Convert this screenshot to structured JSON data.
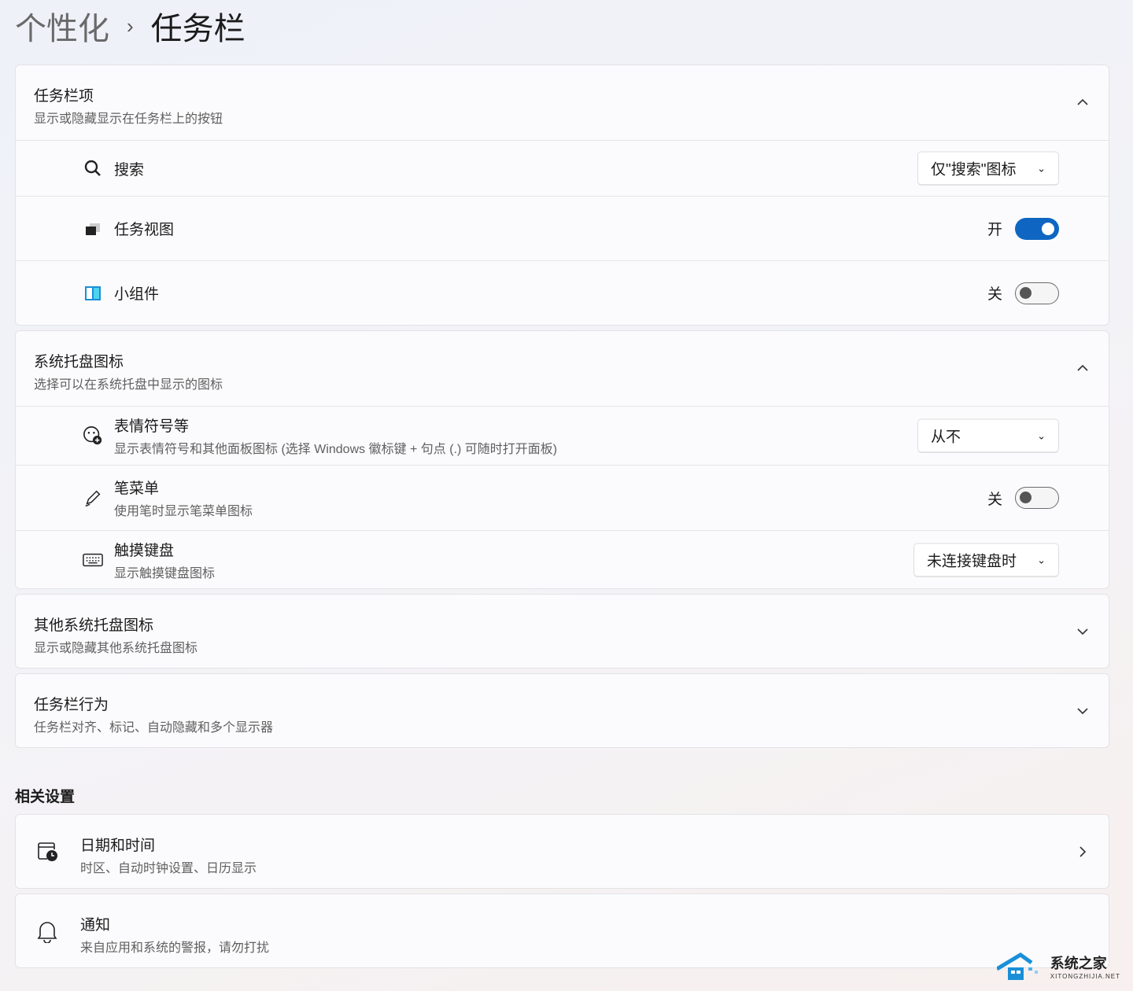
{
  "breadcrumb": {
    "parent": "个性化",
    "separator": "›",
    "current": "任务栏"
  },
  "taskbar_items": {
    "title": "任务栏项",
    "subtitle": "显示或隐藏显示在任务栏上的按钮",
    "search": {
      "label": "搜索",
      "value": "仅\"搜索\"图标"
    },
    "task_view": {
      "label": "任务视图",
      "state": "开",
      "on": true
    },
    "widgets": {
      "label": "小组件",
      "state": "关",
      "on": false
    }
  },
  "tray_icons": {
    "title": "系统托盘图标",
    "subtitle": "选择可以在系统托盘中显示的图标",
    "emoji": {
      "label": "表情符号等",
      "desc": "显示表情符号和其他面板图标 (选择 Windows 徽标键 + 句点 (.) 可随时打开面板)",
      "value": "从不"
    },
    "pen": {
      "label": "笔菜单",
      "desc": "使用笔时显示笔菜单图标",
      "state": "关",
      "on": false
    },
    "keyboard": {
      "label": "触摸键盘",
      "desc": "显示触摸键盘图标",
      "value": "未连接键盘时"
    }
  },
  "other_tray": {
    "title": "其他系统托盘图标",
    "subtitle": "显示或隐藏其他系统托盘图标"
  },
  "behavior": {
    "title": "任务栏行为",
    "subtitle": "任务栏对齐、标记、自动隐藏和多个显示器"
  },
  "related": {
    "heading": "相关设置",
    "datetime": {
      "title": "日期和时间",
      "subtitle": "时区、自动时钟设置、日历显示"
    },
    "notifications": {
      "title": "通知",
      "subtitle": "来自应用和系统的警报，请勿打扰"
    }
  },
  "watermark": {
    "name": "系统之家",
    "url": "XITONGZHIJIA.NET"
  },
  "colors": {
    "accent": "#0f66c2"
  }
}
